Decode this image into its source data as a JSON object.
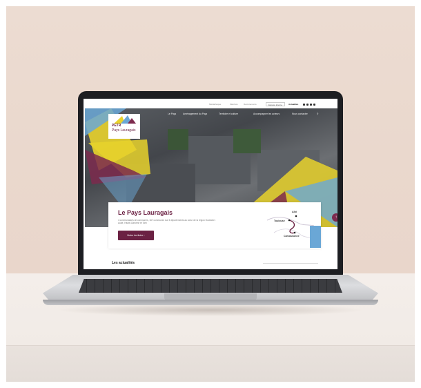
{
  "site": {
    "utility_links": [
      "Médiathèque",
      "Marchés",
      "Recrutements"
    ],
    "espace_button": "Espace interne",
    "actualites_link": "Actualités",
    "nav_items": [
      "Le Pays",
      "Aménagement du Pays",
      "Territoire et culture",
      "Accompagner les acteurs",
      "Nous contacter"
    ]
  },
  "logo": {
    "line1": "PETR",
    "line2": "Pays Lauragais"
  },
  "hero_card": {
    "title": "Le Pays Lauragais",
    "description": "4 communautés de communes, 167 communes sur 3 départements au cœur de la région Occitanie : Aude, Haute-Garonne et Tarn",
    "button": "Notre territoire  ›"
  },
  "map": {
    "labels": [
      "Albi",
      "Toulouse",
      "Carcassonne"
    ]
  },
  "news_heading": "Les actualités",
  "fab_icon": "↑",
  "colors": {
    "brand": "#6b2143",
    "yellow": "#e8d22c",
    "blue": "#6aa7d6"
  }
}
